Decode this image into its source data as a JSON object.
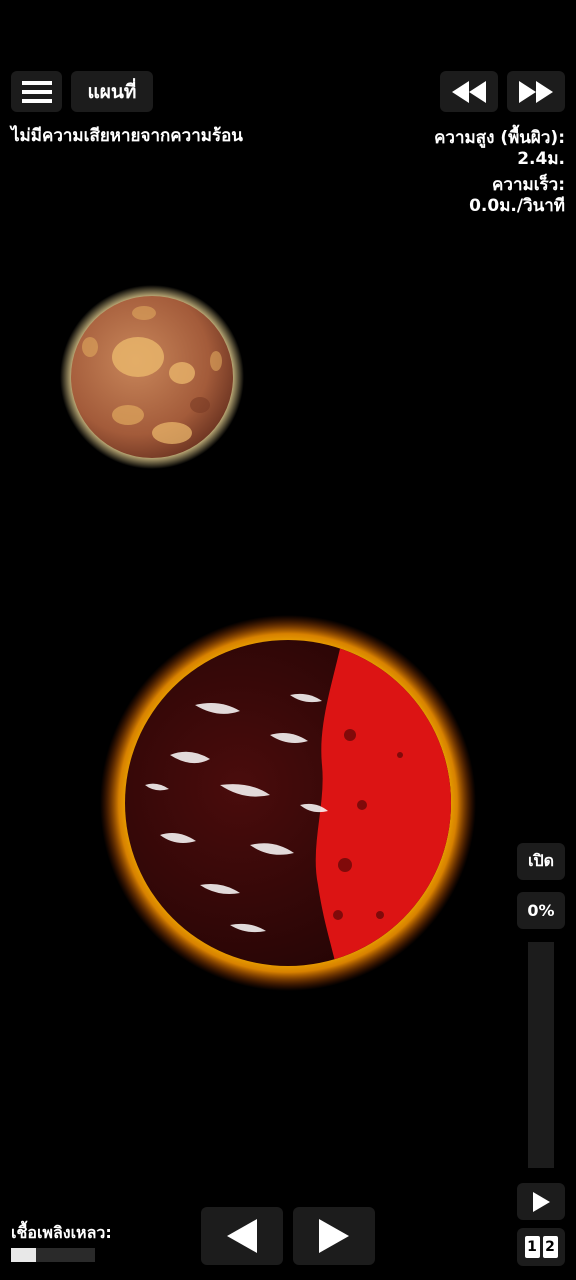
{
  "toolbar": {
    "menu_icon": "hamburger-icon",
    "map_label": "แผนที่",
    "rewind_icon": "rewind-icon",
    "fast_forward_icon": "fast-forward-icon"
  },
  "status": {
    "heat_message": "ไม่มีความเสียหายจากความร้อน",
    "altitude_label": "ความสูง (พื้นผิว):",
    "altitude_value": "2.4ม.",
    "speed_label": "ความเร็ว:",
    "speed_value": "0.0ม./วินาที"
  },
  "throttle": {
    "open_label": "เปิด",
    "percent_label": "0%",
    "level": 0
  },
  "controls": {
    "play_icon": "play-icon",
    "camera_1": "1",
    "camera_2": "2",
    "rotate_left_icon": "triangle-left-icon",
    "rotate_right_icon": "triangle-right-icon"
  },
  "fuel": {
    "label": "เชื้อเพลิงเหลว:",
    "level": 0.3
  },
  "colors": {
    "background": "#000000",
    "button_bg": "#1c1c1c",
    "sun_glow": "#f5c400",
    "star_red": "#d41212",
    "planet_tan": "#c8865a"
  }
}
